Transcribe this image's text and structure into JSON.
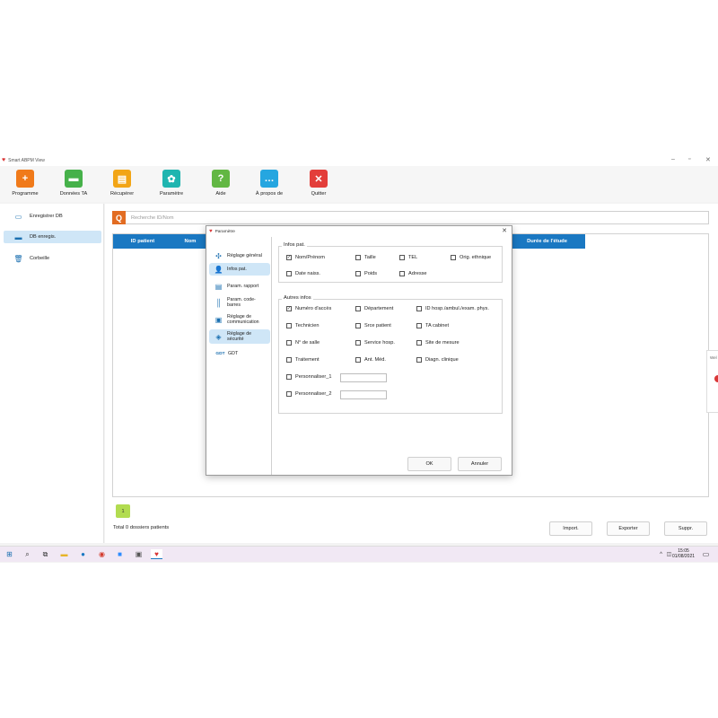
{
  "window": {
    "title": "Smart ABPM View"
  },
  "toolbar": [
    {
      "label": "Programme",
      "icon": "add-user-icon",
      "color": "#f07a1a",
      "glyph": "+"
    },
    {
      "label": "Données TA",
      "icon": "folder-icon",
      "color": "#46b14a",
      "glyph": "▬"
    },
    {
      "label": "Récupérer",
      "icon": "file-icon",
      "color": "#f2a516",
      "glyph": "▤"
    },
    {
      "label": "Paramètre",
      "icon": "gear-icon",
      "color": "#1fb5b0",
      "glyph": "✿"
    },
    {
      "label": "Aide",
      "icon": "help-icon",
      "color": "#62b743",
      "glyph": "?"
    },
    {
      "label": "À propos de",
      "icon": "chat-icon",
      "color": "#25a6e0",
      "glyph": "…"
    },
    {
      "label": "Quitter",
      "icon": "close-icon",
      "color": "#e33e3a",
      "glyph": "✕"
    }
  ],
  "sidebar": {
    "items": [
      {
        "label": "Enregistrer DB",
        "icon": "save-icon",
        "glyph": "▭",
        "active": false
      },
      {
        "label": "DB enregis.",
        "icon": "folder-icon",
        "glyph": "▬",
        "active": true
      },
      {
        "label": "Corbeille",
        "icon": "trash-icon",
        "glyph": "🗑",
        "active": false
      }
    ]
  },
  "main": {
    "search_placeholder": "Recherche ID/Nom",
    "columns": [
      "ID patient",
      "Nom",
      "Durée de l'étude"
    ],
    "page": "1",
    "total": "Total 0 dossiers patients",
    "buttons": {
      "import": "Import.",
      "export": "Exporter",
      "delete": "Suppr."
    }
  },
  "side_peek": {
    "text": "Wel"
  },
  "taskbar": {
    "time": "15:05",
    "date": "01/08/2021"
  },
  "dialog": {
    "title": "Paramètre",
    "nav": [
      {
        "label": "Réglage général",
        "icon": "settings-icon",
        "glyph": "✣",
        "active": false
      },
      {
        "label": "Infos pat.",
        "icon": "user-icon",
        "glyph": "👤",
        "active": true
      },
      {
        "label": "Param. rapport",
        "icon": "report-icon",
        "glyph": "▤",
        "active": false
      },
      {
        "label": "Param. code-barres",
        "icon": "barcode-icon",
        "glyph": "║",
        "active": false
      },
      {
        "label": "Réglage de communication",
        "icon": "communication-icon",
        "glyph": "▣",
        "active": false
      },
      {
        "label": "Réglage de sécurité",
        "icon": "shield-icon",
        "glyph": "◈",
        "active": false
      },
      {
        "label": "GDT",
        "icon": "gdt-icon",
        "glyph": "GDT",
        "active": false
      }
    ],
    "patient_group": {
      "title": "Infos pat.",
      "fields": [
        {
          "label": "Nom/Prénom",
          "checked": true
        },
        {
          "label": "Taille",
          "checked": false
        },
        {
          "label": "TEL",
          "checked": false
        },
        {
          "label": "Orig. ethnique",
          "checked": false
        },
        {
          "label": "Date naiss.",
          "checked": false
        },
        {
          "label": "Poids",
          "checked": false
        },
        {
          "label": "Adresse",
          "checked": false
        }
      ]
    },
    "other_group": {
      "title": "Autres infos",
      "fields": [
        {
          "label": "Numéro d'accès",
          "checked": true
        },
        {
          "label": "Département",
          "checked": false
        },
        {
          "label": "ID hosp./ambul./exam. phys.",
          "checked": false
        },
        {
          "label": "Technicien",
          "checked": false
        },
        {
          "label": "Srce patient",
          "checked": false
        },
        {
          "label": "TA cabinet",
          "checked": false
        },
        {
          "label": "N° de salle",
          "checked": false
        },
        {
          "label": "Service hosp.",
          "checked": false
        },
        {
          "label": "Site de mesure",
          "checked": false
        },
        {
          "label": "Traitement",
          "checked": false
        },
        {
          "label": "Ant. Méd.",
          "checked": false
        },
        {
          "label": "Diagn. clinique",
          "checked": false
        },
        {
          "label": "Personnaliser_1",
          "checked": false,
          "value": ""
        },
        {
          "label": "Personnaliser_2",
          "checked": false,
          "value": ""
        }
      ]
    },
    "ok": "OK",
    "cancel": "Annuler"
  }
}
